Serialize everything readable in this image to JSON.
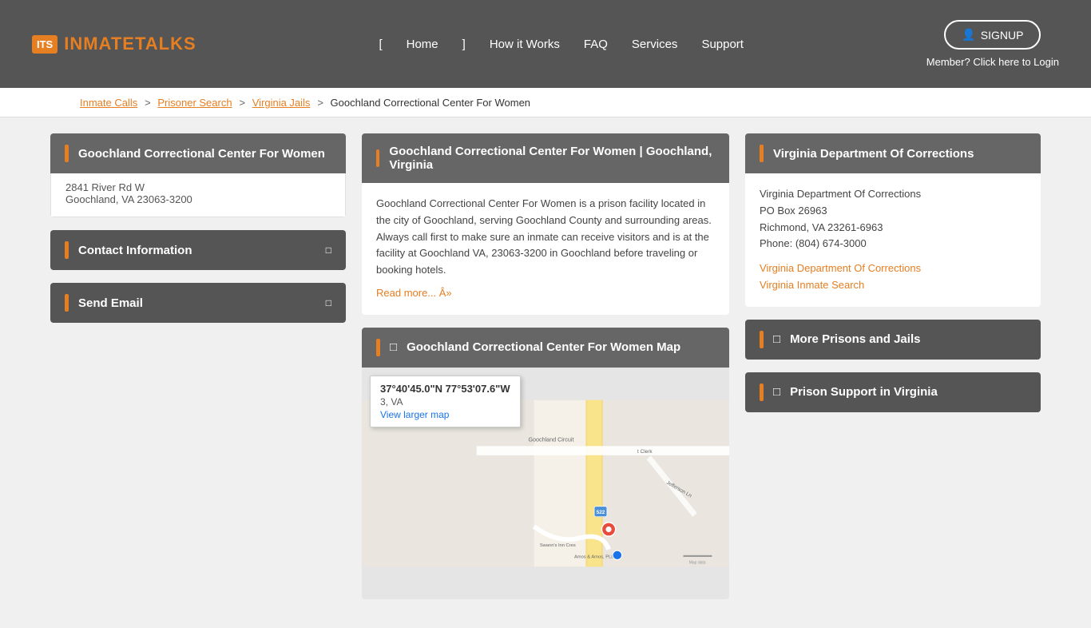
{
  "header": {
    "logo_text": "INMATE",
    "logo_text2": "TALKS",
    "logo_abbr": "ITS",
    "nav": {
      "home": "Home",
      "how_it_works": "How it Works",
      "faq": "FAQ",
      "services": "Services",
      "support": "Support"
    },
    "signup_btn": "SIGNUP",
    "member_text": "Member? Click here to Login"
  },
  "breadcrumb": {
    "inmate_calls": "Inmate Calls",
    "prisoner_search": "Prisoner Search",
    "virginia_jails": "Virginia Jails",
    "current": "Goochland Correctional Center For Women"
  },
  "left_col": {
    "facility_card": {
      "title": "Goochland Correctional Center For Women",
      "address_line1": "2841 River Rd W",
      "address_line2": "Goochland, VA 23063-3200"
    },
    "contact_card": {
      "title": "Contact Information",
      "toggle": "□"
    },
    "send_email_card": {
      "title": "Send Email",
      "toggle": "□"
    }
  },
  "center_col": {
    "main_facility_card": {
      "title": "Goochland Correctional Center For Women | Goochland, Virginia",
      "description": "Goochland Correctional Center For Women is a prison facility located in the city of Goochland, serving Goochland County and surrounding areas. Always call first to make sure an inmate can receive visitors and is at the facility at Goochland VA, 23063-3200 in Goochland before traveling or booking hotels.",
      "read_more": "Read more... Â»"
    },
    "map_card": {
      "title": "Goochland Correctional Center For Women Map",
      "title_icon": "□",
      "coords": "37°40'45.0\"N 77°53'07.6\"W",
      "address_short": "3, VA",
      "view_larger_map": "View larger map"
    }
  },
  "right_col": {
    "dept_card": {
      "title": "Virginia Department Of Corrections",
      "line1": "Virginia Department Of Corrections",
      "line2": "PO Box 26963",
      "line3": "Richmond, VA 23261-6963",
      "line4": "Phone: (804) 674-3000",
      "link1": "Virginia Department Of Corrections",
      "link2": "Virginia Inmate Search"
    },
    "more_prisons_card": {
      "title": "More Prisons and Jails",
      "icon": "□"
    },
    "prison_support_card": {
      "title": "Prison Support in Virginia",
      "icon": "□"
    }
  }
}
